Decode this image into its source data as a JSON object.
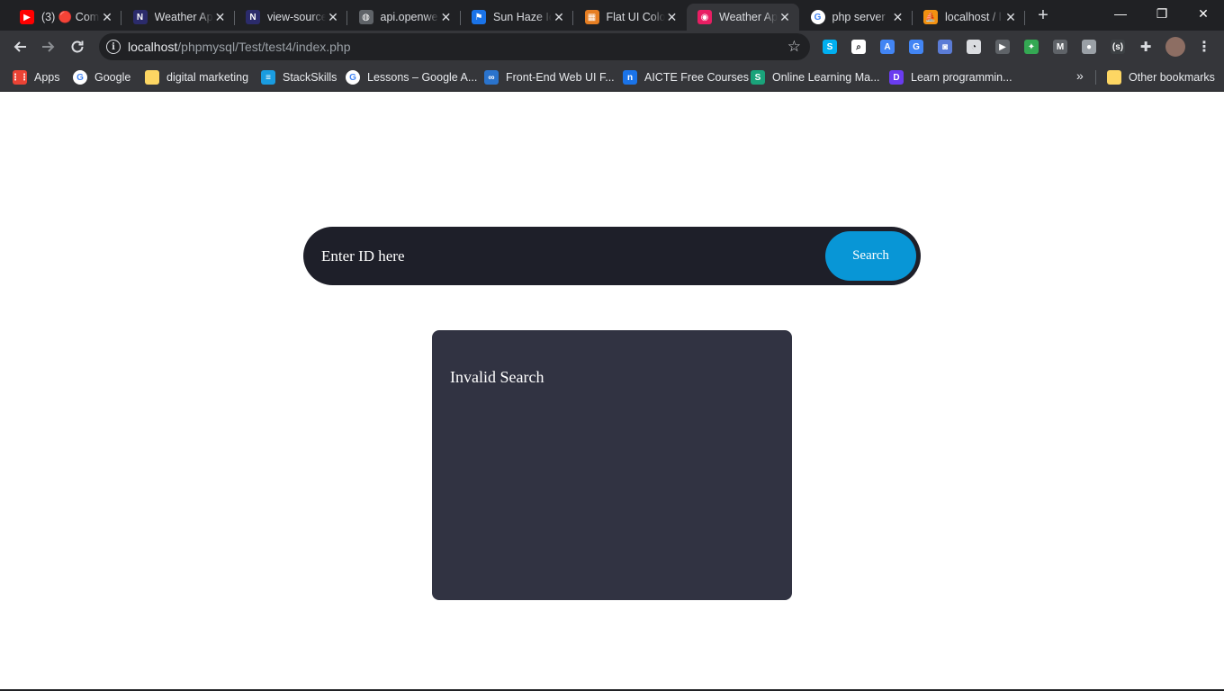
{
  "tabs": [
    {
      "label": "(3) 🔴 Com",
      "icon": "youtube-icon",
      "color": "#ff0000",
      "glyph": "▶"
    },
    {
      "label": "Weather App",
      "icon": "codepen-icon",
      "color": "#2b2b6b",
      "glyph": "N"
    },
    {
      "label": "view-source",
      "icon": "codepen-icon",
      "color": "#2b2b6b",
      "glyph": "N"
    },
    {
      "label": "api.openwe",
      "icon": "globe-icon",
      "color": "#5f6368",
      "glyph": "◍"
    },
    {
      "label": "Sun Haze Ic",
      "icon": "flag-icon",
      "color": "#1a73e8",
      "glyph": "⚑"
    },
    {
      "label": "Flat UI Colo",
      "icon": "color-grid-icon",
      "color": "#e67e22",
      "glyph": "▦"
    },
    {
      "label": "Weather Ap",
      "icon": "weather-app-icon",
      "color": "#e91e63",
      "glyph": "◉"
    },
    {
      "label": "php server",
      "icon": "google-icon",
      "color": "#ffffff",
      "glyph": "G"
    },
    {
      "label": "localhost / l",
      "icon": "phpmyadmin-icon",
      "color": "#f29111",
      "glyph": "⛵"
    }
  ],
  "active_tab": 6,
  "window_controls": {
    "minimize": "—",
    "restore": "❐",
    "close": "✕"
  },
  "address": {
    "host": "localhost",
    "path": "/phpmysql/Test/test4/index.php"
  },
  "extensions": [
    {
      "name": "skype-ext-icon",
      "color": "#00aff0",
      "glyph": "S"
    },
    {
      "name": "search-ext-icon",
      "color": "#ffffff",
      "glyph": "⌕"
    },
    {
      "name": "translate-ext-icon",
      "color": "#4285f4",
      "glyph": "A"
    },
    {
      "name": "google-translate-ext-icon",
      "color": "#4285f4",
      "glyph": "G"
    },
    {
      "name": "camera-ext-icon",
      "color": "#5b7cd6",
      "glyph": "◙"
    },
    {
      "name": "speed-ext-icon",
      "color": "#dadce0",
      "glyph": "◔"
    },
    {
      "name": "video-ext-icon",
      "color": "#5f6368",
      "glyph": "▶"
    },
    {
      "name": "colorful-ext-icon",
      "color": "#34a853",
      "glyph": "✦"
    },
    {
      "name": "m-ext-icon",
      "color": "#5f6368",
      "glyph": "M"
    },
    {
      "name": "circle-ext-icon",
      "color": "#9aa0a6",
      "glyph": "●"
    },
    {
      "name": "bracket-ext-icon",
      "color": "#3c4043",
      "glyph": "(s)"
    }
  ],
  "bookmarks": [
    {
      "label": "Apps",
      "icon": "apps-grid-icon",
      "color": "#ea4335",
      "glyph": "⋮⋮"
    },
    {
      "label": "Google",
      "icon": "google-icon",
      "color": "#ffffff",
      "glyph": "G"
    },
    {
      "label": "digital marketing",
      "icon": "folder-icon",
      "color": "#fdd663",
      "glyph": ""
    },
    {
      "label": "StackSkills",
      "icon": "stackskills-icon",
      "color": "#1a9ce0",
      "glyph": "≡"
    },
    {
      "label": "Lessons – Google A...",
      "icon": "google-icon",
      "color": "#ffffff",
      "glyph": "G"
    },
    {
      "label": "Front-End Web UI F...",
      "icon": "coursera-icon",
      "color": "#2a73cc",
      "glyph": "∞"
    },
    {
      "label": "AICTE Free Courses",
      "icon": "nptel-icon",
      "color": "#1a73e8",
      "glyph": "n"
    },
    {
      "label": "Online Learning Ma...",
      "icon": "sv-icon",
      "color": "#1aa37a",
      "glyph": "S"
    },
    {
      "label": "Learn programmin...",
      "icon": "d-logo-icon",
      "color": "#6a3cf0",
      "glyph": "D"
    }
  ],
  "other_bookmarks": "Other bookmarks",
  "search": {
    "placeholder": "Enter ID here",
    "value": "",
    "button_label": "Search"
  },
  "result": {
    "message": "Invalid Search"
  }
}
